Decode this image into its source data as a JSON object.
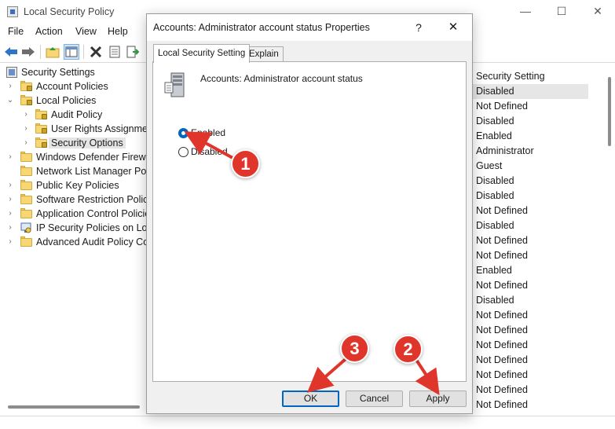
{
  "window": {
    "title": "Local Security Policy",
    "controls": {
      "minimize": "—",
      "maximize": "☐",
      "close": "✕"
    }
  },
  "menu": [
    "File",
    "Action",
    "View",
    "Help"
  ],
  "toolbar": [
    "back-arrow-icon",
    "forward-arrow-icon",
    "up-folder-icon",
    "show-tree-icon",
    "delete-icon",
    "properties-icon",
    "export-icon"
  ],
  "tree": {
    "root": "Security Settings",
    "items": [
      {
        "label": "Account Policies"
      },
      {
        "label": "Local Policies"
      },
      {
        "label": "Audit Policy"
      },
      {
        "label": "User Rights Assignment"
      },
      {
        "label": "Security Options"
      },
      {
        "label": "Windows Defender Firewall"
      },
      {
        "label": "Network List Manager Polic"
      },
      {
        "label": "Public Key Policies"
      },
      {
        "label": "Software Restriction Policie"
      },
      {
        "label": "Application Control Policie"
      },
      {
        "label": "IP Security Policies on Loca"
      },
      {
        "label": "Advanced Audit Policy Con"
      }
    ]
  },
  "right_pane": {
    "header": "Security Setting",
    "values": [
      "Disabled",
      "Not Defined",
      "Disabled",
      "Enabled",
      "Administrator",
      "Guest",
      "Disabled",
      "Disabled",
      "Not Defined",
      "Disabled",
      "Not Defined",
      "Not Defined",
      "Enabled",
      "Not Defined",
      "Disabled",
      "Not Defined",
      "Not Defined",
      "Not Defined",
      "Not Defined",
      "Not Defined",
      "Not Defined",
      "Not Defined"
    ]
  },
  "dialog": {
    "title": "Accounts: Administrator account status Properties",
    "help": "?",
    "close": "✕",
    "tabs": [
      "Local Security Setting",
      "Explain"
    ],
    "policy_name": "Accounts: Administrator account status",
    "options": [
      {
        "label": "Enabled",
        "checked": true
      },
      {
        "label": "Disabled",
        "checked": false
      }
    ],
    "buttons": {
      "ok": "OK",
      "cancel": "Cancel",
      "apply": "Apply"
    }
  },
  "annotations": {
    "badges": [
      "1",
      "2",
      "3"
    ],
    "color": "#e0352b"
  }
}
